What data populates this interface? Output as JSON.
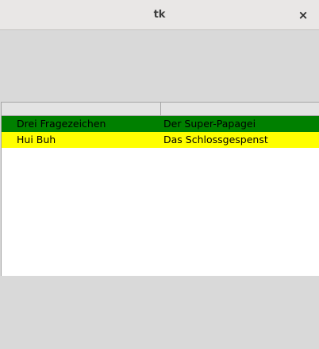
{
  "window": {
    "title": "tk",
    "close_glyph": "×"
  },
  "tree": {
    "columns": [
      "",
      ""
    ],
    "rows": [
      {
        "cells": [
          "Drei Fragezeichen",
          "Der Super-Papagei"
        ],
        "background": "#008000"
      },
      {
        "cells": [
          "Hui Buh",
          "Das Schlossgespenst"
        ],
        "background": "#ffff00"
      }
    ]
  }
}
